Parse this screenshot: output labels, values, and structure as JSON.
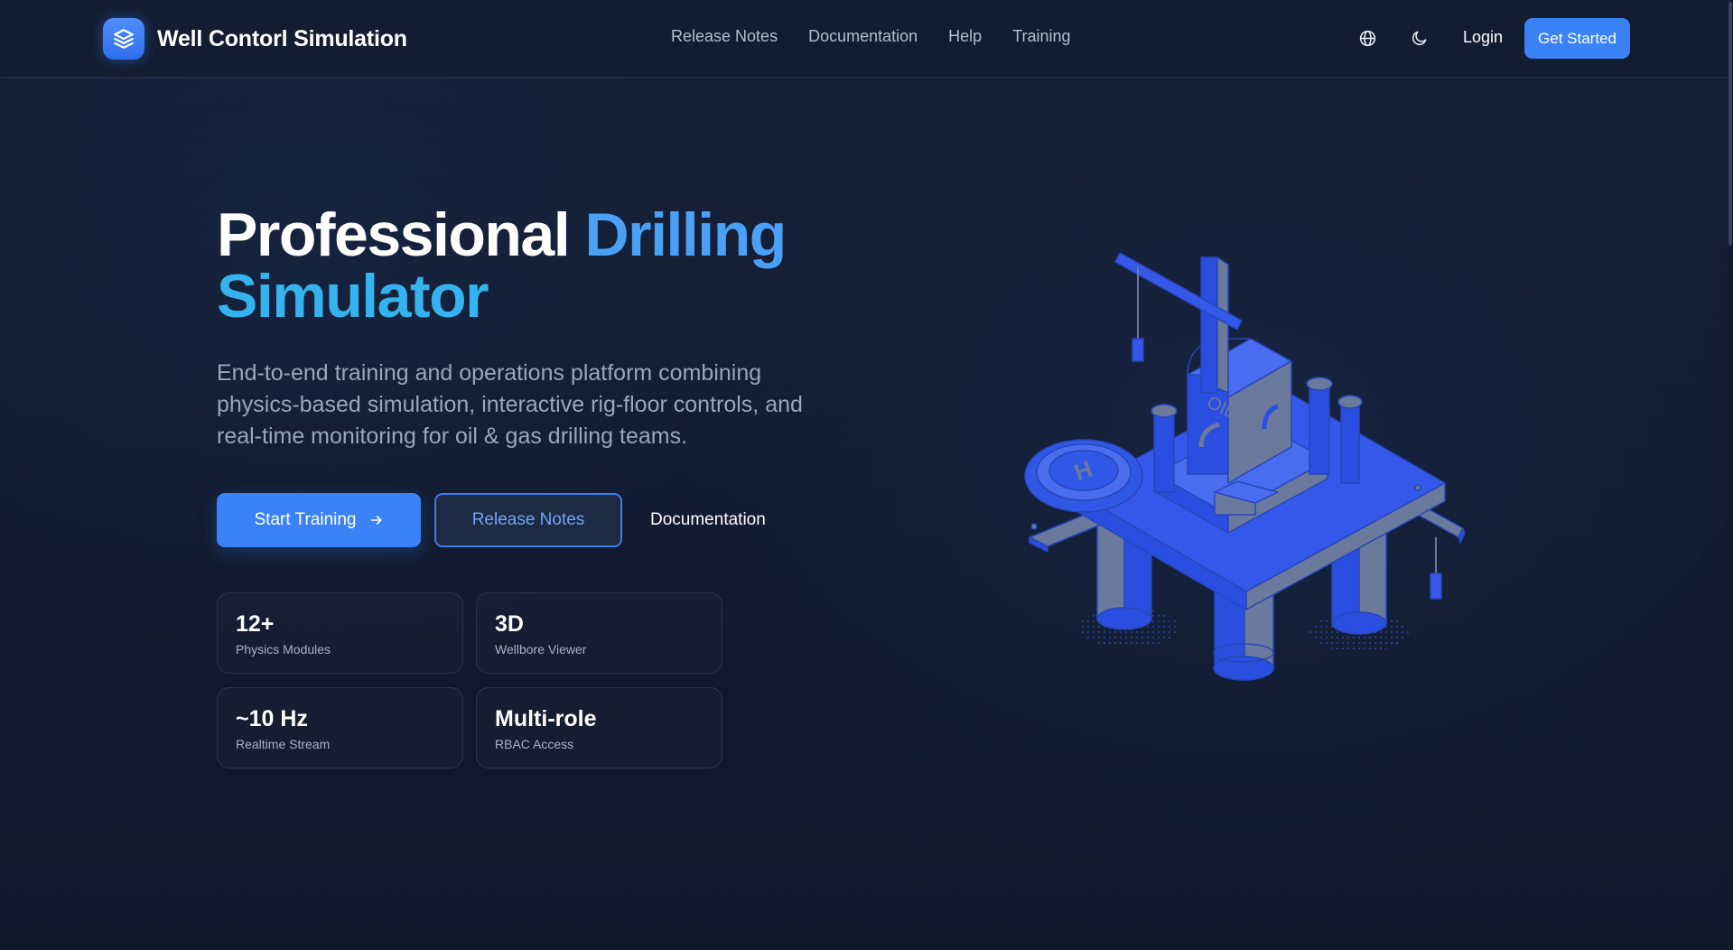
{
  "header": {
    "brand_title": "Well Contorl Simulation",
    "nav": [
      "Release Notes",
      "Documentation",
      "Help",
      "Training"
    ],
    "login_label": "Login",
    "cta_label": "Get Started",
    "language_icon": "globe-icon",
    "theme_icon": "moon-icon"
  },
  "hero": {
    "title_white": "Professional",
    "title_accent_1": "Drilling",
    "title_accent_2": "Simulator",
    "description": "End-to-end training and operations platform combining physics-based simulation, interactive rig-floor controls, and real-time monitoring for oil & gas drilling teams.",
    "primary_button": "Start Training",
    "primary_button_icon": "arrow-right-icon",
    "secondary_button": "Release Notes",
    "tertiary_button": "Documentation"
  },
  "stats": [
    {
      "value": "12+",
      "label": "Physics Modules"
    },
    {
      "value": "3D",
      "label": "Wellbore Viewer"
    },
    {
      "value": "~10 Hz",
      "label": "Realtime Stream"
    },
    {
      "value": "Multi-role",
      "label": "RBAC Access"
    }
  ],
  "illustration": {
    "name": "offshore-oil-rig-illustration",
    "helipad_letter": "H",
    "tank_label": "OIL"
  },
  "colors": {
    "background": "#111a2d",
    "accent": "#3b82f6",
    "title_accent_1": "#4aa0f5",
    "title_accent_2": "#35b3ee",
    "rig_blue": "#2f58e6"
  }
}
